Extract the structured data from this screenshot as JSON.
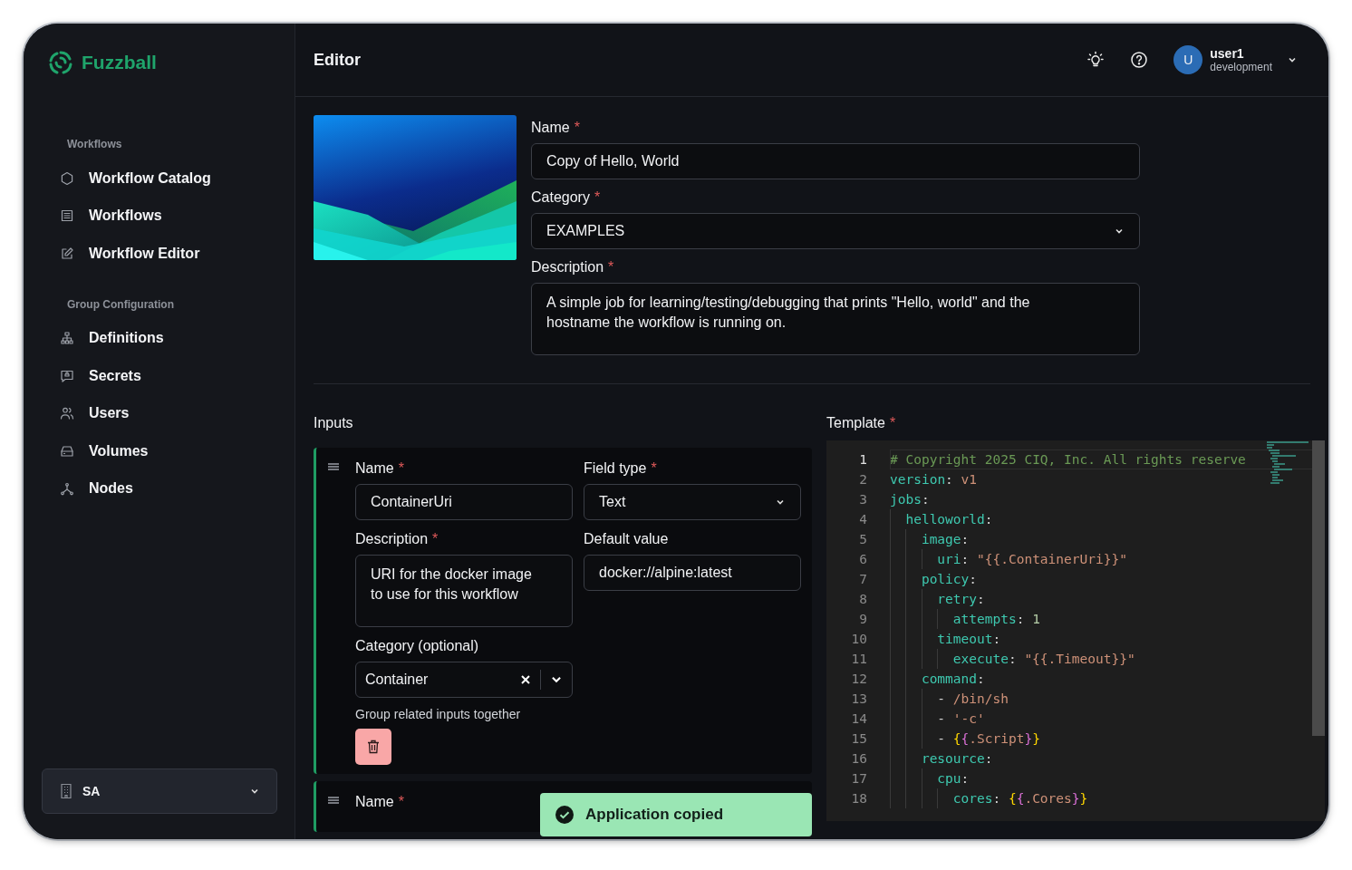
{
  "app": {
    "name": "Fuzzball"
  },
  "sidebar": {
    "sections": [
      {
        "heading": "Workflows",
        "items": [
          {
            "label": "Workflow Catalog"
          },
          {
            "label": "Workflows"
          },
          {
            "label": "Workflow Editor"
          }
        ]
      },
      {
        "heading": "Group Configuration",
        "items": [
          {
            "label": "Definitions"
          },
          {
            "label": "Secrets"
          },
          {
            "label": "Users"
          },
          {
            "label": "Volumes"
          },
          {
            "label": "Nodes"
          }
        ]
      }
    ],
    "org_switcher": {
      "label": "SA"
    }
  },
  "header": {
    "title": "Editor",
    "user": {
      "initial": "U",
      "name": "user1",
      "role": "development"
    }
  },
  "details": {
    "fields": [
      {
        "kind": "input",
        "label": "Name",
        "required_mark": "*",
        "value": "Copy of Hello, World"
      },
      {
        "kind": "select",
        "label": "Category",
        "required_mark": "*",
        "value": "EXAMPLES"
      },
      {
        "kind": "textarea",
        "label": "Description",
        "required_mark": "*",
        "value": "A simple job for learning/testing/debugging that prints \"Hello, world\" and the hostname the workflow is running on."
      }
    ]
  },
  "inputs": {
    "title": "Inputs",
    "cards": [
      {
        "fields": [
          {
            "kind": "input",
            "label": "Name",
            "required_mark": "*",
            "value": "ContainerUri"
          },
          {
            "kind": "select",
            "label": "Field type",
            "required_mark": "*",
            "value": "Text"
          },
          {
            "kind": "textarea",
            "label": "Description",
            "required_mark": "*",
            "value": "URI for the docker image to use for this workflow"
          },
          {
            "kind": "input",
            "label": "Default value",
            "value": "docker://alpine:latest"
          },
          {
            "kind": "combo",
            "label": "Category (optional)",
            "value": "Container",
            "hint": "Group related inputs together"
          }
        ]
      },
      {
        "fields": [
          {
            "kind": "label",
            "label": "Name",
            "required_mark": "*"
          }
        ]
      }
    ]
  },
  "template": {
    "title": "Template",
    "required_mark": "*",
    "lines": [
      {
        "n": "1",
        "current": true,
        "tokens": [
          {
            "kind": "comment",
            "text": "# Copyright 2025 CIQ, Inc. All rights reserve"
          }
        ]
      },
      {
        "n": "2",
        "current": false,
        "tokens": [
          {
            "kind": "key",
            "text": "version"
          },
          {
            "kind": "punct",
            "text": ": "
          },
          {
            "kind": "string",
            "text": "v1"
          }
        ]
      },
      {
        "n": "3",
        "current": false,
        "tokens": [
          {
            "kind": "key",
            "text": "jobs"
          },
          {
            "kind": "punct",
            "text": ":"
          }
        ]
      },
      {
        "n": "4",
        "current": false,
        "tokens": [
          {
            "kind": "key",
            "text": "  helloworld"
          },
          {
            "kind": "punct",
            "text": ":"
          }
        ]
      },
      {
        "n": "5",
        "current": false,
        "tokens": [
          {
            "kind": "key",
            "text": "    image"
          },
          {
            "kind": "punct",
            "text": ":"
          }
        ]
      },
      {
        "n": "6",
        "current": false,
        "tokens": [
          {
            "kind": "key",
            "text": "      uri"
          },
          {
            "kind": "punct",
            "text": ": "
          },
          {
            "kind": "string",
            "text": "\"{{.ContainerUri}}\""
          }
        ]
      },
      {
        "n": "7",
        "current": false,
        "tokens": [
          {
            "kind": "key",
            "text": "    policy"
          },
          {
            "kind": "punct",
            "text": ":"
          }
        ]
      },
      {
        "n": "8",
        "current": false,
        "tokens": [
          {
            "kind": "key",
            "text": "      retry"
          },
          {
            "kind": "punct",
            "text": ":"
          }
        ]
      },
      {
        "n": "9",
        "current": false,
        "tokens": [
          {
            "kind": "key",
            "text": "        attempts"
          },
          {
            "kind": "punct",
            "text": ": "
          },
          {
            "kind": "number",
            "text": "1"
          }
        ]
      },
      {
        "n": "10",
        "current": false,
        "tokens": [
          {
            "kind": "key",
            "text": "      timeout"
          },
          {
            "kind": "punct",
            "text": ":"
          }
        ]
      },
      {
        "n": "11",
        "current": false,
        "tokens": [
          {
            "kind": "key",
            "text": "        execute"
          },
          {
            "kind": "punct",
            "text": ": "
          },
          {
            "kind": "string",
            "text": "\"{{.Timeout}}\""
          }
        ]
      },
      {
        "n": "12",
        "current": false,
        "tokens": [
          {
            "kind": "key",
            "text": "    command"
          },
          {
            "kind": "punct",
            "text": ":"
          }
        ]
      },
      {
        "n": "13",
        "current": false,
        "tokens": [
          {
            "kind": "punct",
            "text": "      - "
          },
          {
            "kind": "string",
            "text": "/bin/sh"
          }
        ]
      },
      {
        "n": "14",
        "current": false,
        "tokens": [
          {
            "kind": "punct",
            "text": "      - "
          },
          {
            "kind": "string",
            "text": "'-c'"
          }
        ]
      },
      {
        "n": "15",
        "current": false,
        "tokens": [
          {
            "kind": "punct",
            "text": "      - "
          },
          {
            "kind": "brace",
            "text": "{"
          },
          {
            "kind": "brace2",
            "text": "{"
          },
          {
            "kind": "string",
            "text": ".Script"
          },
          {
            "kind": "brace2",
            "text": "}"
          },
          {
            "kind": "brace",
            "text": "}"
          }
        ]
      },
      {
        "n": "16",
        "current": false,
        "tokens": [
          {
            "kind": "key",
            "text": "    resource"
          },
          {
            "kind": "punct",
            "text": ":"
          }
        ]
      },
      {
        "n": "17",
        "current": false,
        "tokens": [
          {
            "kind": "key",
            "text": "      cpu"
          },
          {
            "kind": "punct",
            "text": ":"
          }
        ]
      },
      {
        "n": "18",
        "current": false,
        "tokens": [
          {
            "kind": "key",
            "text": "        cores"
          },
          {
            "kind": "punct",
            "text": ": "
          },
          {
            "kind": "brace",
            "text": "{"
          },
          {
            "kind": "brace2",
            "text": "{"
          },
          {
            "kind": "string",
            "text": ".Cores"
          },
          {
            "kind": "brace2",
            "text": "}"
          },
          {
            "kind": "brace",
            "text": "}"
          }
        ]
      }
    ]
  },
  "toast": {
    "message": "Application copied"
  }
}
